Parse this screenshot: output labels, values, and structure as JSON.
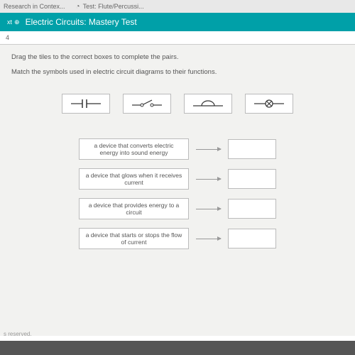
{
  "browser": {
    "bookmarks": [
      {
        "label": "Research in Contex..."
      },
      {
        "label": "Test: Flute/Percussi..."
      }
    ]
  },
  "header": {
    "nav_label": "xt",
    "title": "Electric Circuits: Mastery Test"
  },
  "question_number": "4",
  "instructions": {
    "line1": "Drag the tiles to the correct boxes to complete the pairs.",
    "line2": "Match the symbols used in electric circuit diagrams to their functions."
  },
  "tiles": [
    {
      "name": "capacitor-symbol"
    },
    {
      "name": "open-switch-symbol"
    },
    {
      "name": "buzzer-symbol"
    },
    {
      "name": "lamp-symbol"
    }
  ],
  "pairs": [
    {
      "desc": "a device that converts electric energy into sound energy"
    },
    {
      "desc": "a device that glows when it receives current"
    },
    {
      "desc": "a device that provides energy to a circuit"
    },
    {
      "desc": "a device that starts or stops the flow of current"
    }
  ],
  "footer": "s reserved."
}
